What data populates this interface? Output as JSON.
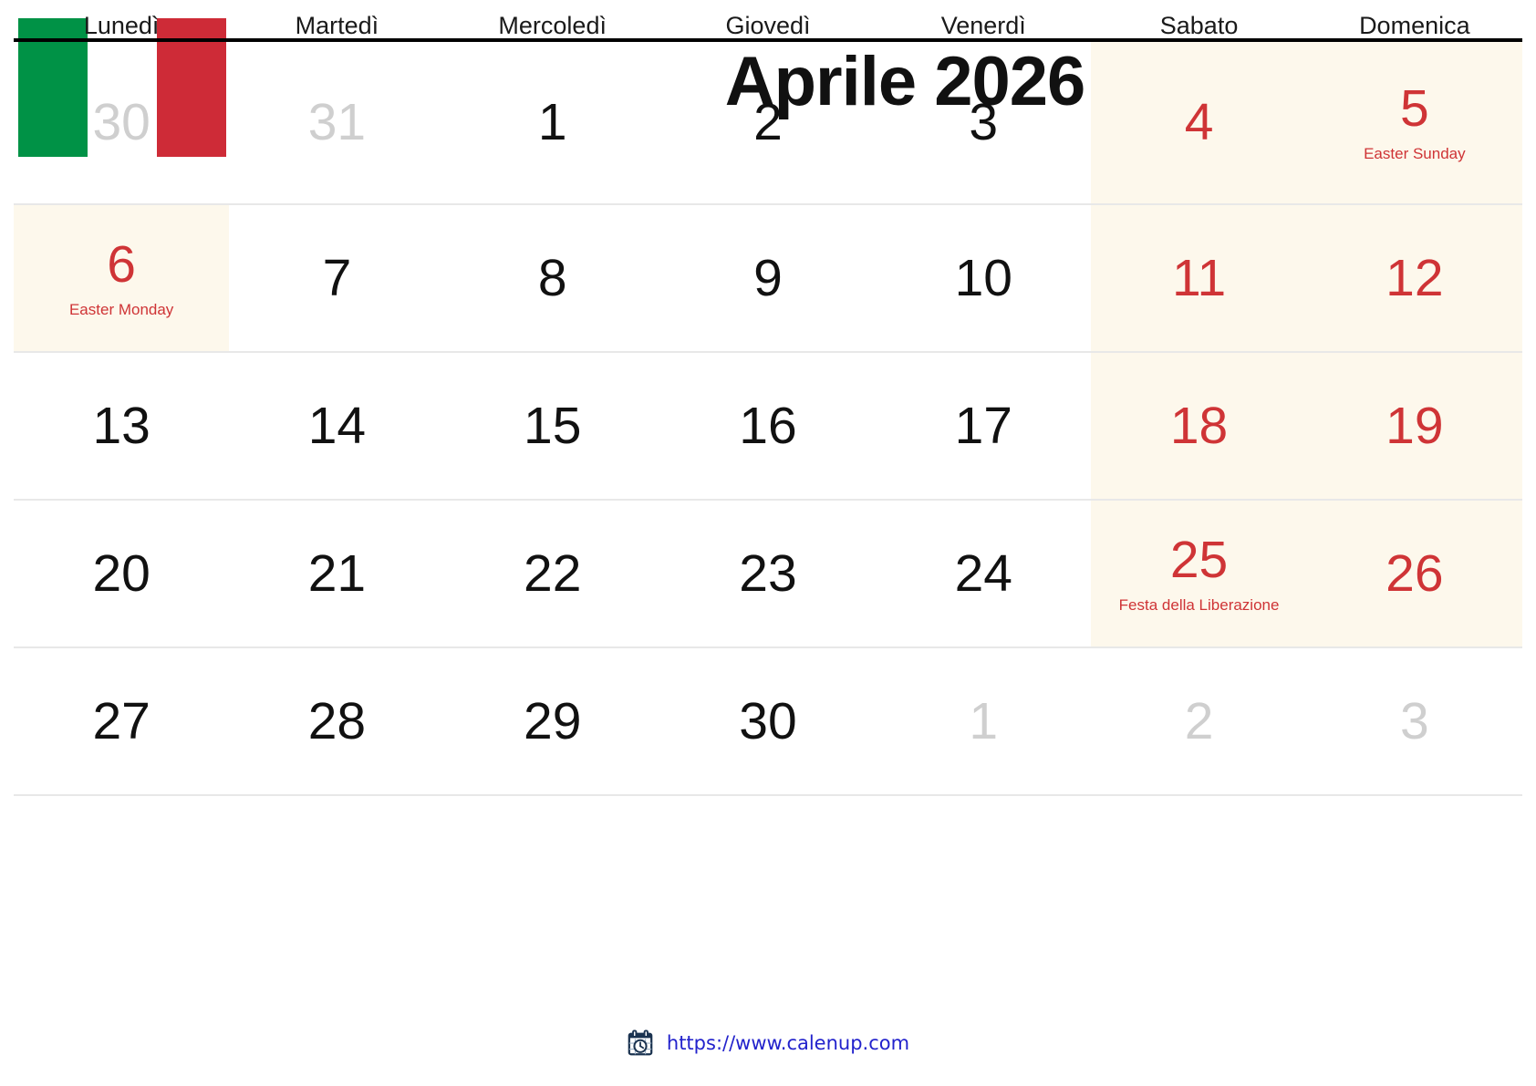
{
  "flag": {
    "name": "italy-flag",
    "stripes": [
      "#009246",
      "#ffffff",
      "#ce2b37"
    ]
  },
  "header": {
    "title": "Aprile 2026",
    "month": "Aprile",
    "year": "2026"
  },
  "weekdays": [
    "Lunedì",
    "Martedì",
    "Mercoledì",
    "Giovedì",
    "Venerdì",
    "Sabato",
    "Domenica"
  ],
  "colors": {
    "holiday_red": "#cf3436",
    "weekend_tint": "#fdf8ec",
    "out_of_month": "#cfcfcf",
    "header_rule": "#000000",
    "row_rule": "#e8e8e8",
    "link_blue": "#2222cc"
  },
  "weeks": [
    [
      {
        "num": "30",
        "out": true,
        "red": false,
        "tint": false,
        "note": ""
      },
      {
        "num": "31",
        "out": true,
        "red": false,
        "tint": false,
        "note": ""
      },
      {
        "num": "1",
        "out": false,
        "red": false,
        "tint": false,
        "note": ""
      },
      {
        "num": "2",
        "out": false,
        "red": false,
        "tint": false,
        "note": ""
      },
      {
        "num": "3",
        "out": false,
        "red": false,
        "tint": false,
        "note": ""
      },
      {
        "num": "4",
        "out": false,
        "red": true,
        "tint": true,
        "note": ""
      },
      {
        "num": "5",
        "out": false,
        "red": true,
        "tint": true,
        "note": "Easter Sunday"
      }
    ],
    [
      {
        "num": "6",
        "out": false,
        "red": true,
        "tint": true,
        "note": "Easter Monday"
      },
      {
        "num": "7",
        "out": false,
        "red": false,
        "tint": false,
        "note": ""
      },
      {
        "num": "8",
        "out": false,
        "red": false,
        "tint": false,
        "note": ""
      },
      {
        "num": "9",
        "out": false,
        "red": false,
        "tint": false,
        "note": ""
      },
      {
        "num": "10",
        "out": false,
        "red": false,
        "tint": false,
        "note": ""
      },
      {
        "num": "11",
        "out": false,
        "red": true,
        "tint": true,
        "note": ""
      },
      {
        "num": "12",
        "out": false,
        "red": true,
        "tint": true,
        "note": ""
      }
    ],
    [
      {
        "num": "13",
        "out": false,
        "red": false,
        "tint": false,
        "note": ""
      },
      {
        "num": "14",
        "out": false,
        "red": false,
        "tint": false,
        "note": ""
      },
      {
        "num": "15",
        "out": false,
        "red": false,
        "tint": false,
        "note": ""
      },
      {
        "num": "16",
        "out": false,
        "red": false,
        "tint": false,
        "note": ""
      },
      {
        "num": "17",
        "out": false,
        "red": false,
        "tint": false,
        "note": ""
      },
      {
        "num": "18",
        "out": false,
        "red": true,
        "tint": true,
        "note": ""
      },
      {
        "num": "19",
        "out": false,
        "red": true,
        "tint": true,
        "note": ""
      }
    ],
    [
      {
        "num": "20",
        "out": false,
        "red": false,
        "tint": false,
        "note": ""
      },
      {
        "num": "21",
        "out": false,
        "red": false,
        "tint": false,
        "note": ""
      },
      {
        "num": "22",
        "out": false,
        "red": false,
        "tint": false,
        "note": ""
      },
      {
        "num": "23",
        "out": false,
        "red": false,
        "tint": false,
        "note": ""
      },
      {
        "num": "24",
        "out": false,
        "red": false,
        "tint": false,
        "note": ""
      },
      {
        "num": "25",
        "out": false,
        "red": true,
        "tint": true,
        "note": "Festa della Liberazione"
      },
      {
        "num": "26",
        "out": false,
        "red": true,
        "tint": true,
        "note": ""
      }
    ],
    [
      {
        "num": "27",
        "out": false,
        "red": false,
        "tint": false,
        "note": ""
      },
      {
        "num": "28",
        "out": false,
        "red": false,
        "tint": false,
        "note": ""
      },
      {
        "num": "29",
        "out": false,
        "red": false,
        "tint": false,
        "note": ""
      },
      {
        "num": "30",
        "out": false,
        "red": false,
        "tint": false,
        "note": ""
      },
      {
        "num": "1",
        "out": true,
        "red": false,
        "tint": false,
        "note": ""
      },
      {
        "num": "2",
        "out": true,
        "red": false,
        "tint": false,
        "note": ""
      },
      {
        "num": "3",
        "out": true,
        "red": false,
        "tint": false,
        "note": ""
      }
    ]
  ],
  "footer": {
    "icon": "calendar-clock-icon",
    "url": "https://www.calenup.com"
  }
}
